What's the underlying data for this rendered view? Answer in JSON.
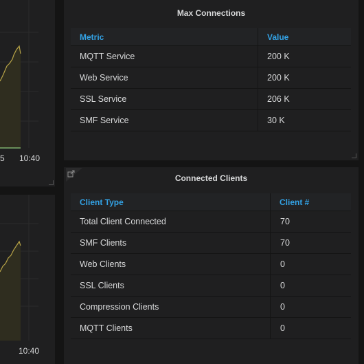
{
  "graph_top": {
    "x_ticks": [
      "5",
      "10:40"
    ]
  },
  "graph_bottom": {
    "x_ticks": [
      "10:40"
    ]
  },
  "max_connections": {
    "title": "Max Connections",
    "columns": [
      "Metric",
      "Value"
    ],
    "rows": [
      {
        "metric": "MQTT Service",
        "value": "200 K"
      },
      {
        "metric": "Web Service",
        "value": "200 K"
      },
      {
        "metric": "SSL Service",
        "value": "206 K"
      },
      {
        "metric": "SMF Service",
        "value": "30 K"
      }
    ]
  },
  "connected_clients": {
    "title": "Connected Clients",
    "columns": [
      "Client Type",
      "Client #"
    ],
    "rows": [
      {
        "type": "Total Client Connected",
        "count": "70"
      },
      {
        "type": "SMF Clients",
        "count": "70"
      },
      {
        "type": "Web Clients",
        "count": "0"
      },
      {
        "type": "SSL Clients",
        "count": "0"
      },
      {
        "type": "Compression Clients",
        "count": "0"
      },
      {
        "type": "MQTT Clients",
        "count": "0"
      }
    ]
  },
  "colors": {
    "accent_header": "#33a2e5",
    "series_line": "#b9a548",
    "series_fill": "#2f2d1f",
    "baseline": "#7eb26d"
  },
  "icons": {
    "panel_link": "external-link-icon",
    "resize": "resize-handle-icon"
  }
}
